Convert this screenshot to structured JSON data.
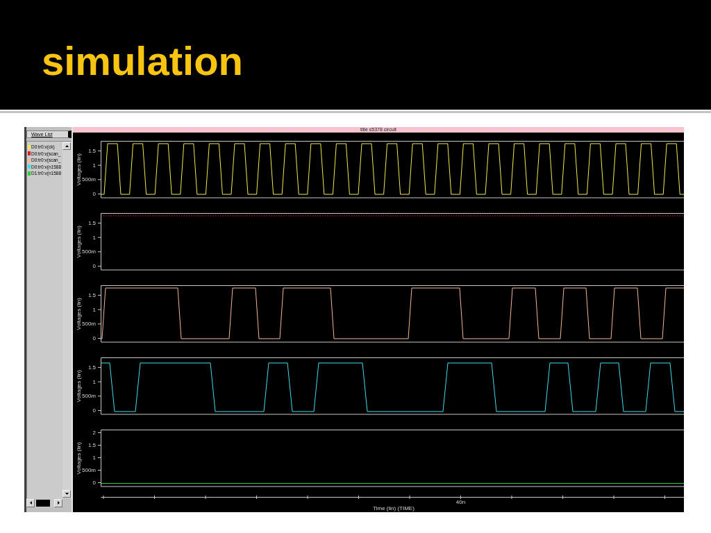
{
  "slide": {
    "title": "simulation"
  },
  "wave_list": {
    "button": "Wave List",
    "signals": [
      {
        "name": "D0:tr0:v(ck)",
        "color": "#f0ea50"
      },
      {
        "name": "D0:tr0:v(scan_",
        "color": "#e02030"
      },
      {
        "name": "D0:tr0:v(scan_",
        "color": "#f5b898"
      },
      {
        "name": "D0:tr0:v(n1588",
        "color": "#40e0ea"
      },
      {
        "name": "D1:tr0:v(n1588",
        "color": "#30d030"
      }
    ]
  },
  "viewer": {
    "title": "title s5378 circuit",
    "panels": [
      {
        "ylabel": "Voltages (lin)",
        "yticks": [
          "1.5",
          "1",
          "500m",
          "0"
        ]
      },
      {
        "ylabel": "Voltages (lin)",
        "yticks": [
          "1.5",
          "1",
          "500m",
          "0"
        ]
      },
      {
        "ylabel": "Voltages (lin)",
        "yticks": [
          "1.5",
          "1",
          "500m",
          "0"
        ]
      },
      {
        "ylabel": "Voltages (lin)",
        "yticks": [
          "1.5",
          "1",
          "500m",
          "0"
        ]
      },
      {
        "ylabel": "Voltages (lin)",
        "yticks": [
          "2",
          "1.5",
          "1",
          "500m",
          "0"
        ]
      }
    ],
    "time_axis": {
      "tick_label": "40n",
      "title": "Time (lin) (TIME)"
    }
  }
}
